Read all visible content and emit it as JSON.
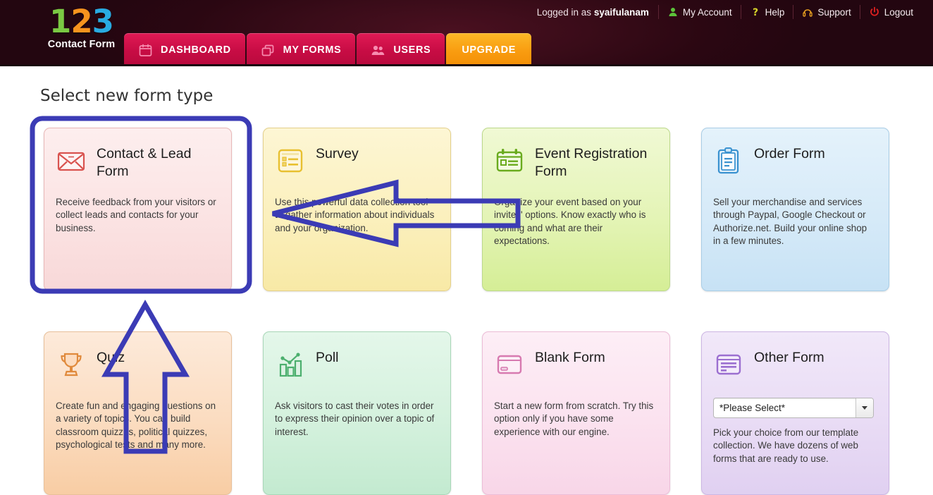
{
  "header": {
    "logo": {
      "digit1": "1",
      "digit2": "2",
      "digit3": "3",
      "subtitle": "Contact Form"
    },
    "logged_in_prefix": "Logged in as ",
    "username": "syaifulanam",
    "user_links": [
      {
        "label": "My Account",
        "icon": "user-icon",
        "color": "#5cc23a"
      },
      {
        "label": "Help",
        "icon": "question-mark-icon",
        "color": "#d8d62a"
      },
      {
        "label": "Support",
        "icon": "headset-icon",
        "color": "#e8a020"
      },
      {
        "label": "Logout",
        "icon": "power-icon",
        "color": "#e02020"
      }
    ],
    "nav_tabs": [
      {
        "label": "DASHBOARD",
        "icon": "calendar-icon",
        "active": false,
        "style": "pink"
      },
      {
        "label": "MY FORMS",
        "icon": "forms-icon",
        "active": false,
        "style": "pink"
      },
      {
        "label": "USERS",
        "icon": "users-icon",
        "active": false,
        "style": "pink"
      },
      {
        "label": "UPGRADE",
        "icon": "",
        "active": false,
        "style": "orange"
      }
    ]
  },
  "main": {
    "page_title": "Select new form type",
    "cards": [
      {
        "title": "Contact & Lead Form",
        "description": "Receive feedback from your visitors or collect leads and contacts for your business.",
        "icon": "envelope-icon",
        "accent": "#d9534f",
        "highlighted": true
      },
      {
        "title": "Survey",
        "description": "Use this powerful data collection tool to gather information about individuals and your organization.",
        "icon": "list-icon",
        "accent": "#e8c030",
        "highlighted": false
      },
      {
        "title": "Event Registration Form",
        "description": "Organize your event based on your invites' options. Know exactly who is coming and what are their expectations.",
        "icon": "calendar-card-icon",
        "accent": "#6aab1e",
        "highlighted": false
      },
      {
        "title": "Order Form",
        "description": "Sell your merchandise and services through Paypal, Google Checkout or Authorize.net. Build your online shop in a few minutes.",
        "icon": "clipboard-icon",
        "accent": "#3a92d0",
        "highlighted": false
      },
      {
        "title": "Quiz",
        "description": "Create fun and engaging questions on a variety of topics. You can build classroom quizzes, political quizzes, psychological tests and many more.",
        "icon": "trophy-icon",
        "accent": "#e08a3c",
        "highlighted": false
      },
      {
        "title": "Poll",
        "description": "Ask visitors to cast their votes in order to express their opinion over a topic of interest.",
        "icon": "bar-chart-icon",
        "accent": "#4caf6e",
        "highlighted": false
      },
      {
        "title": "Blank Form",
        "description": "Start a new form from scratch. Try this option only if you have some experience with our engine.",
        "icon": "window-icon",
        "accent": "#d77ab0",
        "highlighted": false
      },
      {
        "title": "Other Form",
        "description": "Pick your choice from our template collection. We have dozens of web forms that are ready to use.",
        "icon": "document-icon",
        "accent": "#9b6fd0",
        "highlighted": false,
        "select_value": "*Please Select*"
      }
    ]
  },
  "annotations": {
    "highlight_color": "#3b3bb5",
    "arrow_color": "#3b3bb5",
    "left_arrow_label": "left-pointing-arrow",
    "up_arrow_label": "up-pointing-arrow",
    "highlight_label": "highlight-rectangle"
  }
}
